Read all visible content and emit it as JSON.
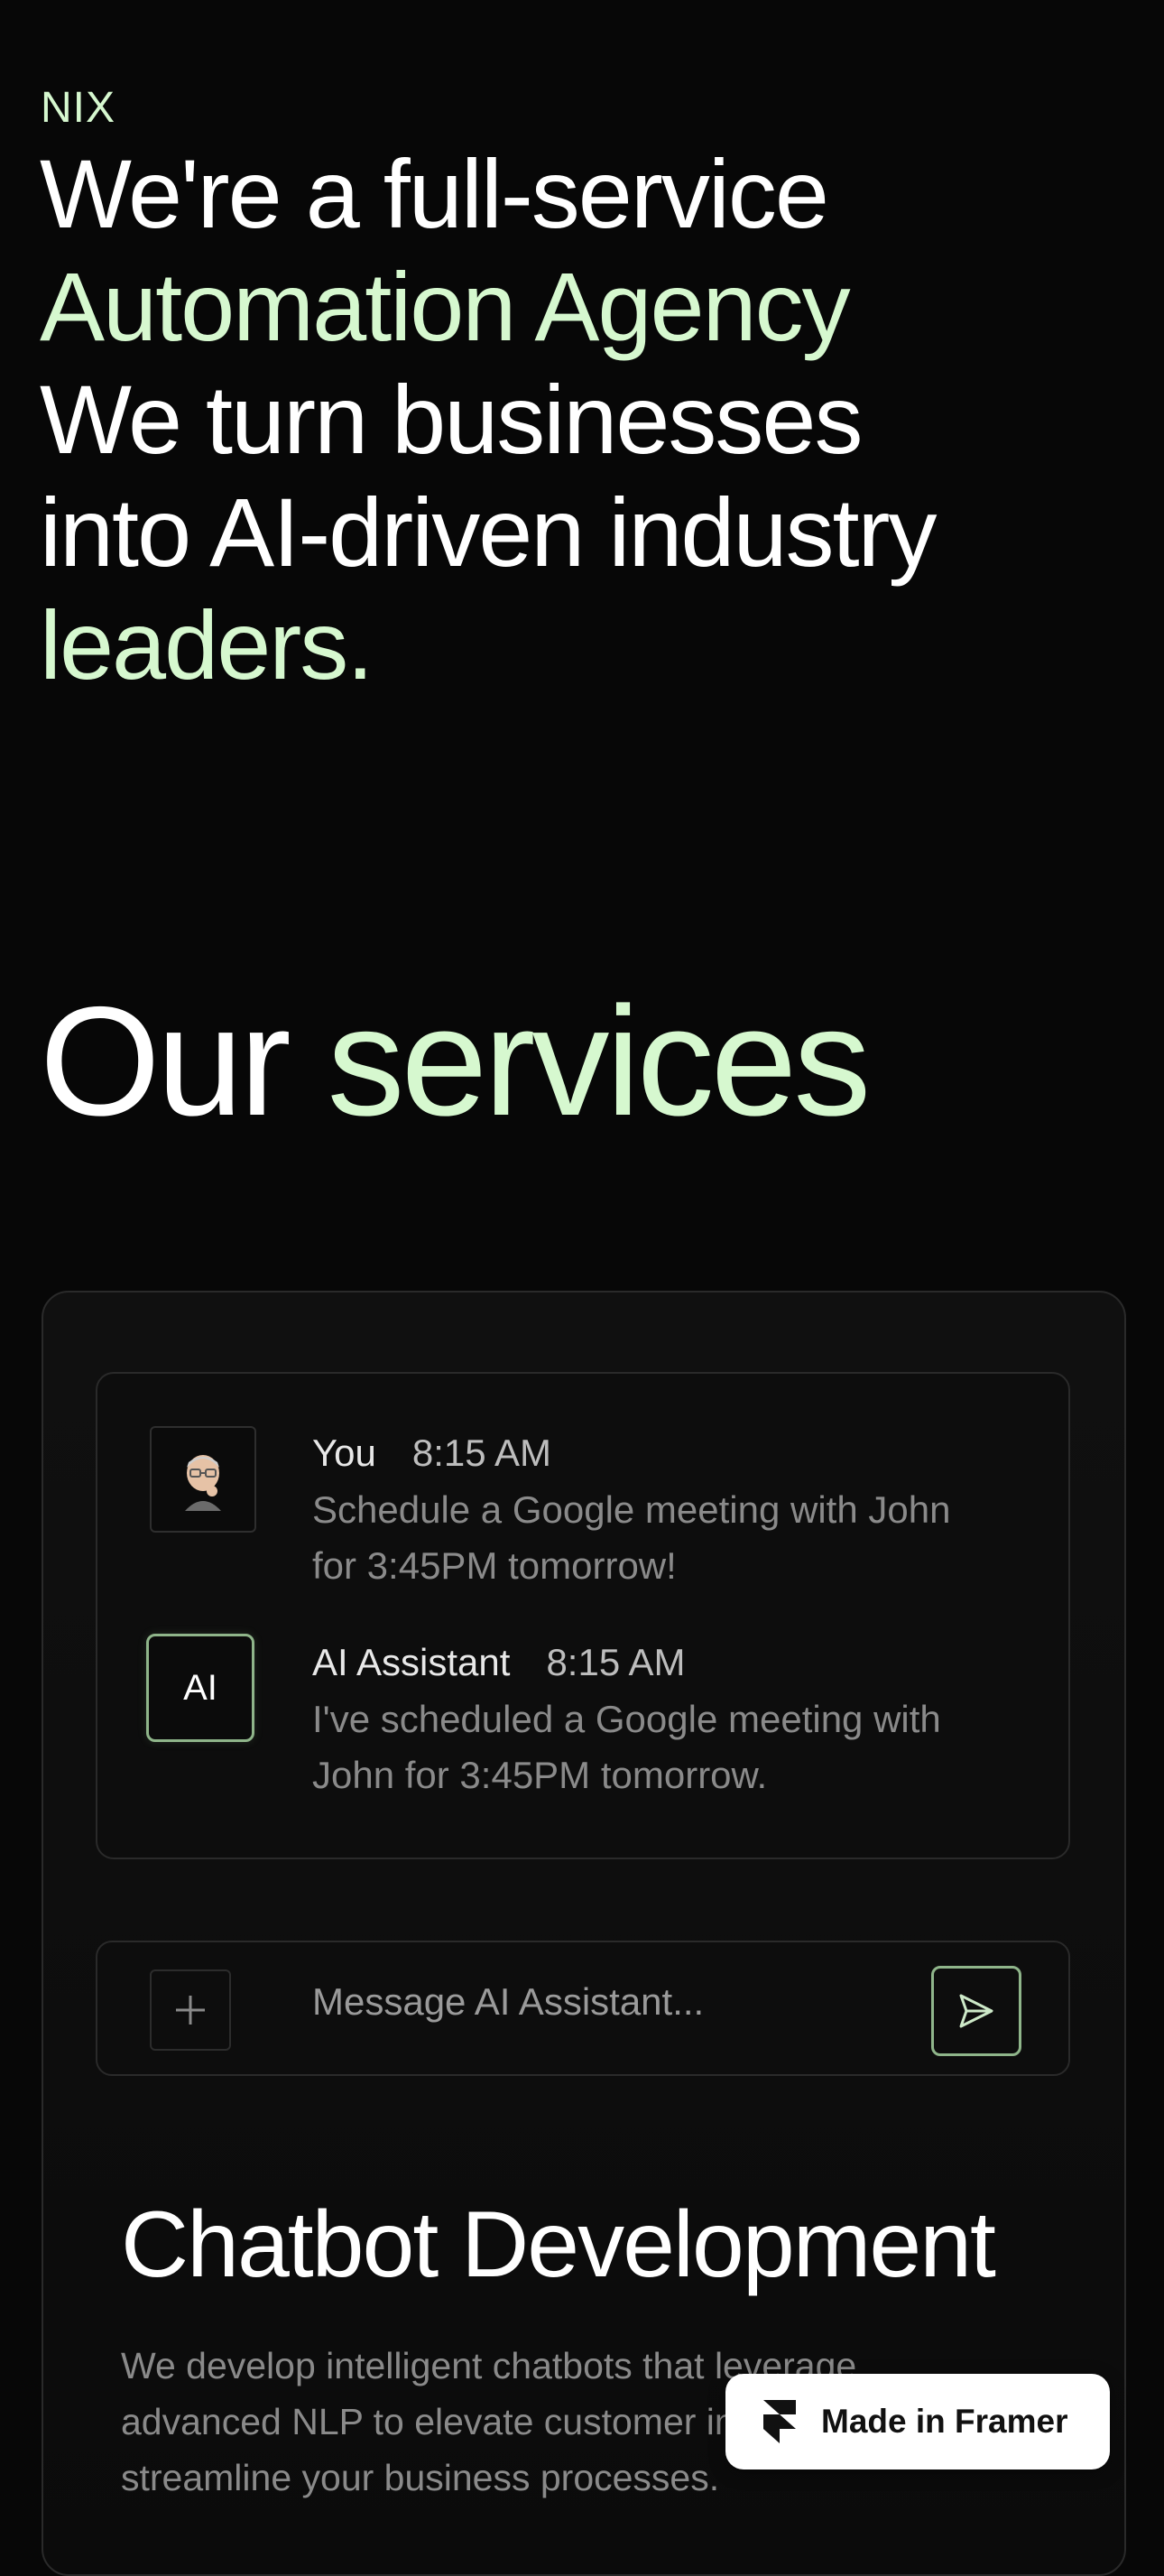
{
  "brand": "NIX",
  "hero": {
    "line1": "We're a full-service",
    "line2": "Automation Agency",
    "line3": "We turn businesses",
    "line4": "into AI-driven industry",
    "line5": "leaders."
  },
  "services_heading": {
    "word1": "Our",
    "word2": "services"
  },
  "chat": {
    "messages": [
      {
        "sender": "You",
        "time": "8:15 AM",
        "text": "Schedule a Google meeting with John for 3:45PM tomorrow!",
        "avatar_icon": "memoji-avatar-icon"
      },
      {
        "sender": "AI Assistant",
        "time": "8:15 AM",
        "text": "I've scheduled a Google meeting with John for 3:45PM tomorrow.",
        "avatar_label": "AI"
      }
    ],
    "input_placeholder": "Message AI Assistant..."
  },
  "service": {
    "title": "Chatbot Development",
    "description": "We develop intelligent chatbots that leverage advanced NLP to elevate customer interactions and streamline your business processes."
  },
  "badge": {
    "label": "Made in Framer",
    "icon": "framer-logo-icon"
  },
  "colors": {
    "accent": "#d6f8cf",
    "background": "#070707",
    "muted_text": "#8a8a8a",
    "ai_border": "#8fb58a"
  }
}
